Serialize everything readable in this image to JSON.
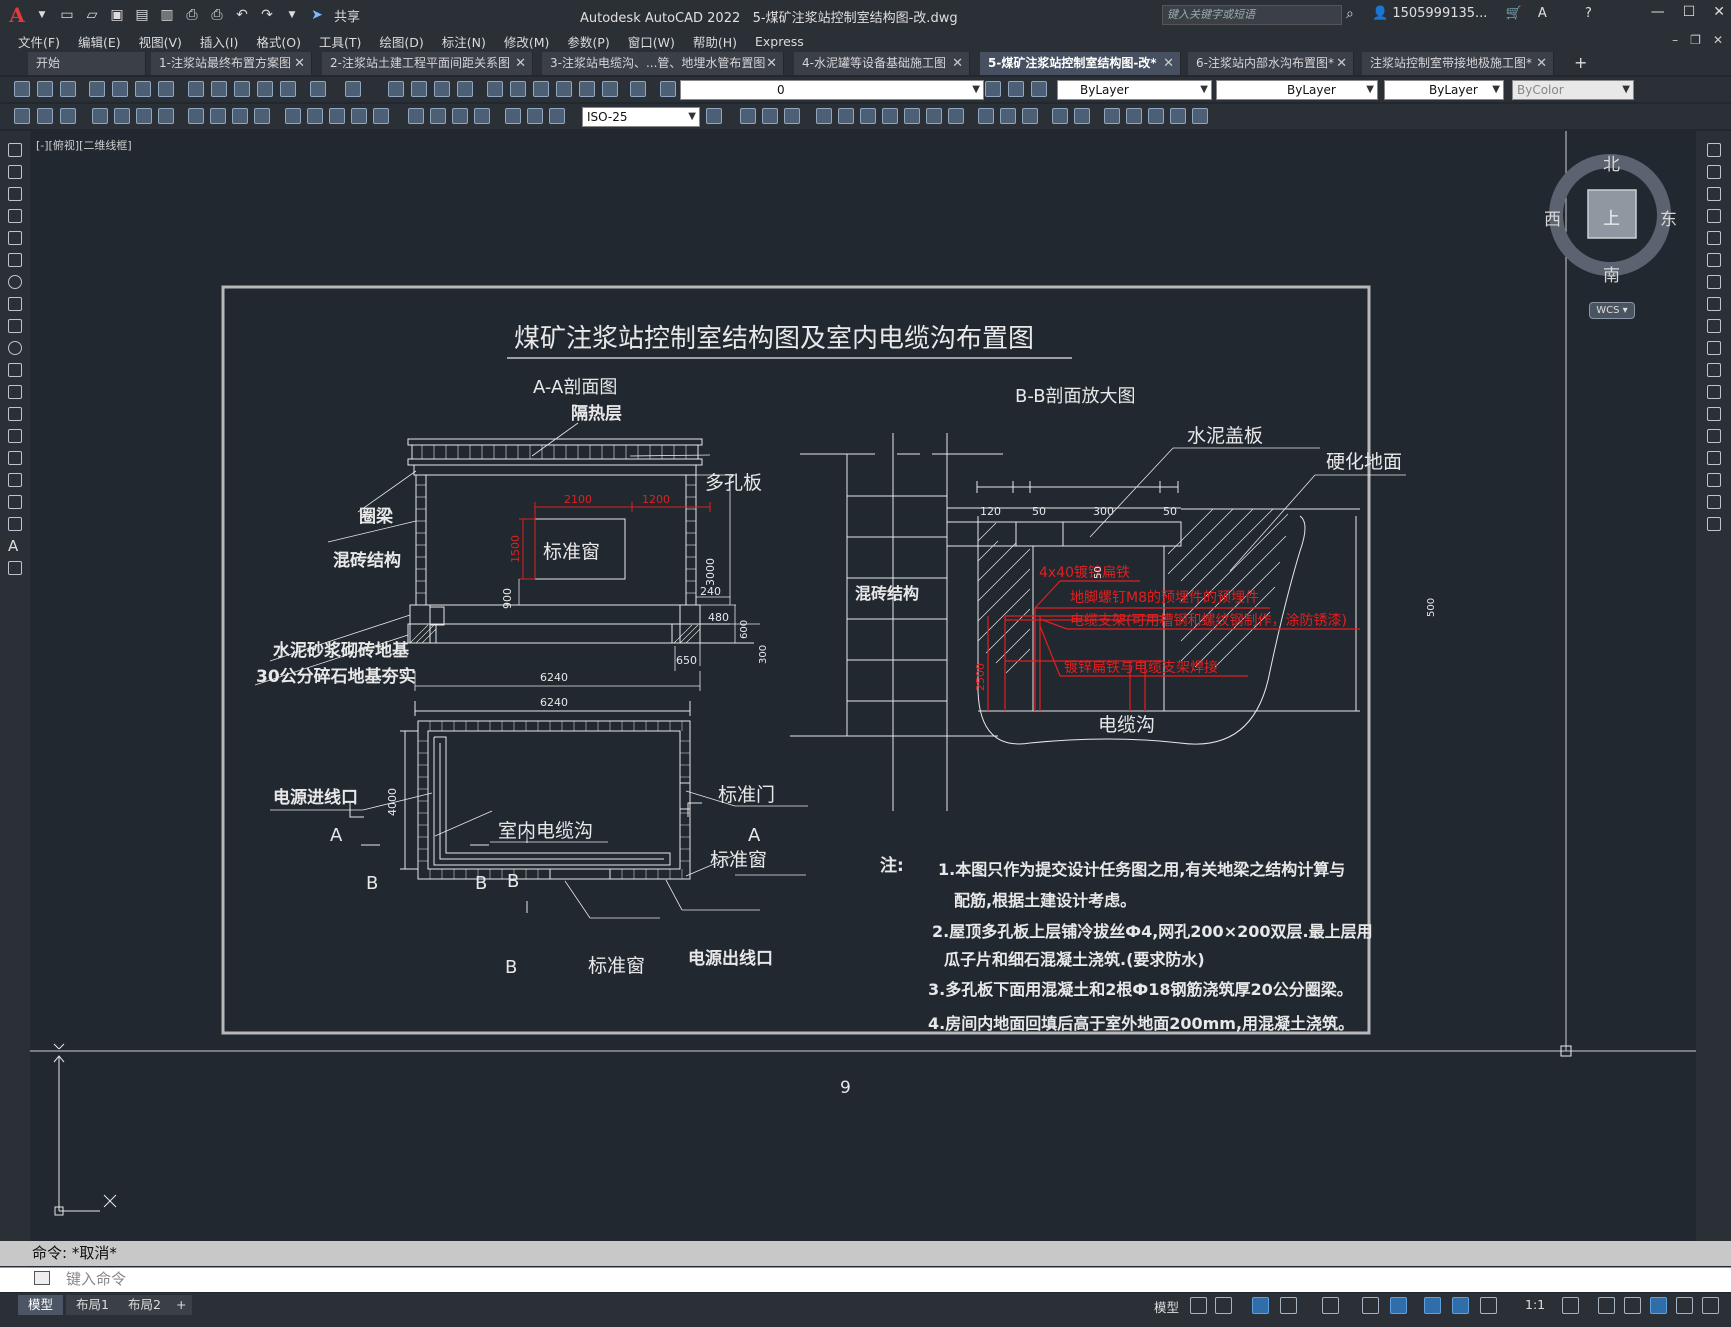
{
  "titlebar": {
    "app_title": "Autodesk AutoCAD 2022",
    "file_title": "5-煤矿注浆站控制室结构图-改.dwg",
    "share_label": "共享",
    "search_placeholder": "键入关键字或短语",
    "user_name": "1505999135..."
  },
  "menu": {
    "items": [
      "文件(F)",
      "编辑(E)",
      "视图(V)",
      "插入(I)",
      "格式(O)",
      "工具(T)",
      "绘图(D)",
      "标注(N)",
      "修改(M)",
      "参数(P)",
      "窗口(W)",
      "帮助(H)",
      "Express"
    ]
  },
  "file_tabs": [
    {
      "label": "开始",
      "active": false,
      "closable": false
    },
    {
      "label": "1-注浆站最终布置方案图",
      "active": false,
      "closable": true
    },
    {
      "label": "2-注浆站土建工程平面间距关系图",
      "active": false,
      "closable": true
    },
    {
      "label": "3-注浆站电缆沟、...管、地埋水管布置图",
      "active": false,
      "closable": true
    },
    {
      "label": "4-水泥罐等设备基础施工图",
      "active": false,
      "closable": true
    },
    {
      "label": "5-煤矿注浆站控制室结构图-改*",
      "active": true,
      "closable": true
    },
    {
      "label": "6-注浆站内部水沟布置图*",
      "active": false,
      "closable": true
    },
    {
      "label": "注浆站控制室带接地极施工图*",
      "active": false,
      "closable": true
    }
  ],
  "toolbar": {
    "layer_value": "0",
    "color_value": "ByLayer",
    "linetype_value": "ByLayer",
    "lineweight_value": "ByLayer",
    "plotstyle_value": "ByColor",
    "dimstyle_value": "ISO-25"
  },
  "viewport": {
    "label": "[-][俯视][二维线框]",
    "viewcube": {
      "north": "北",
      "south": "南",
      "east": "东",
      "west": "西",
      "face": "上"
    },
    "wcs_label": "WCS"
  },
  "drawing": {
    "title": "煤矿注浆站控制室结构图及室内电缆沟布置图",
    "section_aa_title": "A-A剖面图",
    "section_bb_title": "B-B剖面放大图",
    "labels_aa": {
      "insulation": "隔热层",
      "perforated_slab": "多孔板",
      "ring_beam": "圈梁",
      "brick_structure": "混砖结构",
      "window": "标准窗",
      "mortar_base": "水泥砂浆砌砖地基",
      "gravel_base": "30公分碎石地基夯实"
    },
    "dims_aa": {
      "d2100": "2100",
      "d1200": "1200",
      "d1500": "1500",
      "d3000": "3000",
      "d900": "900",
      "d240": "240",
      "d480": "480",
      "d600": "600",
      "d300": "300",
      "d650": "650",
      "d6240a": "6240",
      "d6240b": "6240",
      "d4000": "4000"
    },
    "labels_plan": {
      "power_in": "电源进线口",
      "cable_trench": "室内电缆沟",
      "door": "标准门",
      "window_right": "标准窗",
      "window_bottom": "标准窗",
      "power_out": "电源出线口",
      "mark_a_left": "A",
      "mark_a_right": "A",
      "mark_b_left": "B",
      "mark_b_mid": "B",
      "mark_b_top": "B",
      "mark_b_bottom": "B"
    },
    "labels_bb": {
      "cement_cover": "水泥盖板",
      "hard_ground": "硬化地面",
      "brick_structure": "混砖结构",
      "flat_iron": "4x40镀锌扁铁",
      "anchor_bolt": "地脚螺钉M8的预埋件的预埋件",
      "cable_bracket": "电缆支架(可用槽钢和螺纹钢制作，涂防锈漆)",
      "weld_note": "镀锌扁铁与电缆支架焊接",
      "cable_trench": "电缆沟"
    },
    "dims_bb": {
      "d120": "120",
      "d50a": "50",
      "d300": "300",
      "d50b": "50",
      "d50c": "50",
      "d500": "500",
      "d2500": "2500"
    },
    "notes": {
      "label": "注:",
      "n1a": "1.本图只作为提交设计任务图之用,有关地梁之结构计算与",
      "n1b": "配筋,根据土建设计考虑。",
      "n2a": "2.屋顶多孔板上层铺冷拔丝Ф4,网孔200×200双层.最上层用",
      "n2b": "瓜子片和细石混凝土浇筑.(要求防水)",
      "n3": "3.多孔板下面用混凝土和2根Ф18钢筋浇筑厚20公分圈梁。",
      "n4": "4.房间内地面回填后高于室外地面200mm,用混凝土浇筑。"
    },
    "page_number": "9"
  },
  "command": {
    "history": "命令: *取消*",
    "placeholder": "键入命令"
  },
  "status": {
    "layout_tabs": [
      "模型",
      "布局1",
      "布局2"
    ],
    "model_label": "模型",
    "scale": "1:1"
  },
  "colors": {
    "canvas_bg": "#212830",
    "line_white": "#e8e8e8",
    "line_red": "#e02020",
    "frame_gray": "#b8b8b8"
  }
}
